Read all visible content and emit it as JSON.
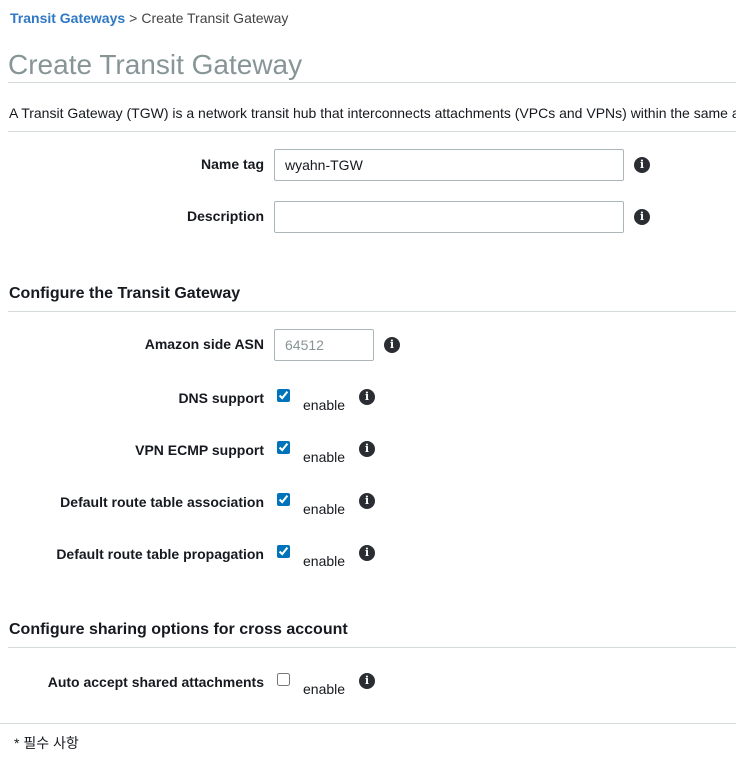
{
  "breadcrumb": {
    "parent": "Transit Gateways",
    "separator": ">",
    "current": "Create Transit Gateway"
  },
  "page_title": "Create Transit Gateway",
  "intro": "A Transit Gateway (TGW) is a network transit hub that interconnects attachments (VPCs and VPNs) within the same a",
  "fields": {
    "name_tag": {
      "label": "Name tag",
      "value": "wyahn-TGW",
      "placeholder": ""
    },
    "description": {
      "label": "Description",
      "value": "",
      "placeholder": ""
    }
  },
  "section_configure": {
    "title": "Configure the Transit Gateway",
    "asn": {
      "label": "Amazon side ASN",
      "value": "",
      "placeholder": "64512"
    },
    "dns_support": {
      "label": "DNS support",
      "checked": true,
      "option": "enable"
    },
    "vpn_ecmp": {
      "label": "VPN ECMP support",
      "checked": true,
      "option": "enable"
    },
    "default_assoc": {
      "label": "Default route table association",
      "checked": true,
      "option": "enable"
    },
    "default_prop": {
      "label": "Default route table propagation",
      "checked": true,
      "option": "enable"
    }
  },
  "section_sharing": {
    "title": "Configure sharing options for cross account",
    "auto_accept": {
      "label": "Auto accept shared attachments",
      "checked": false,
      "option": "enable"
    }
  },
  "footnote": "* 필수 사항",
  "icons": {
    "info": "info-icon",
    "info_glyph": "i"
  },
  "colors": {
    "link": "#2f78c4",
    "title": "#879596",
    "divider": "#d5dbdb",
    "checkbox_accent": "#0073bb"
  }
}
